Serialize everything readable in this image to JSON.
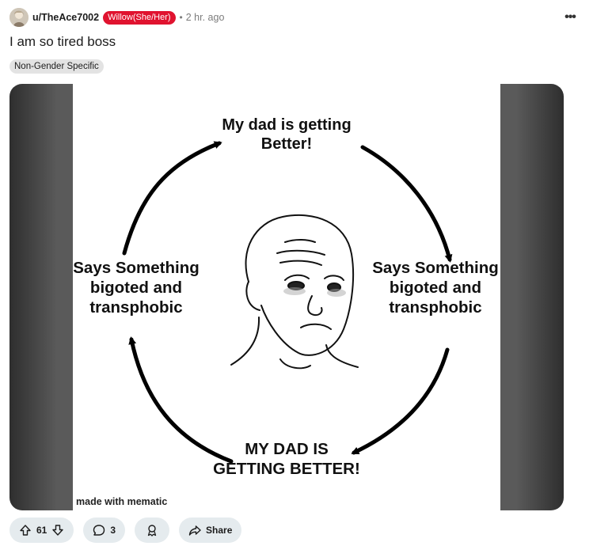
{
  "post": {
    "username": "u/TheAce7002",
    "user_flair": "Willow(She/Her)",
    "separator": "•",
    "time": "2 hr. ago",
    "more_label": "•••",
    "title": "I am so tired boss",
    "post_flair": "Non-Gender Specific"
  },
  "meme": {
    "top_caption": "My dad is getting Better!",
    "left_caption": "Says Something bigoted and transphobic",
    "right_caption": "Says Something bigoted and transphobic",
    "bottom_caption": "MY DAD IS GETTING BETTER!",
    "watermark": "made with mematic"
  },
  "actions": {
    "vote_count": "61",
    "comment_count": "3",
    "share_label": "Share"
  },
  "colors": {
    "user_flair_bg": "#e0132f",
    "pill_bg": "#e5ebee",
    "post_flair_bg": "#e3e3e3"
  },
  "icons": {
    "upvote": "arrow-up-icon",
    "downvote": "arrow-down-icon",
    "comment": "speech-bubble-icon",
    "award": "award-ribbon-icon",
    "share": "share-arrow-icon",
    "more": "ellipsis-icon"
  }
}
